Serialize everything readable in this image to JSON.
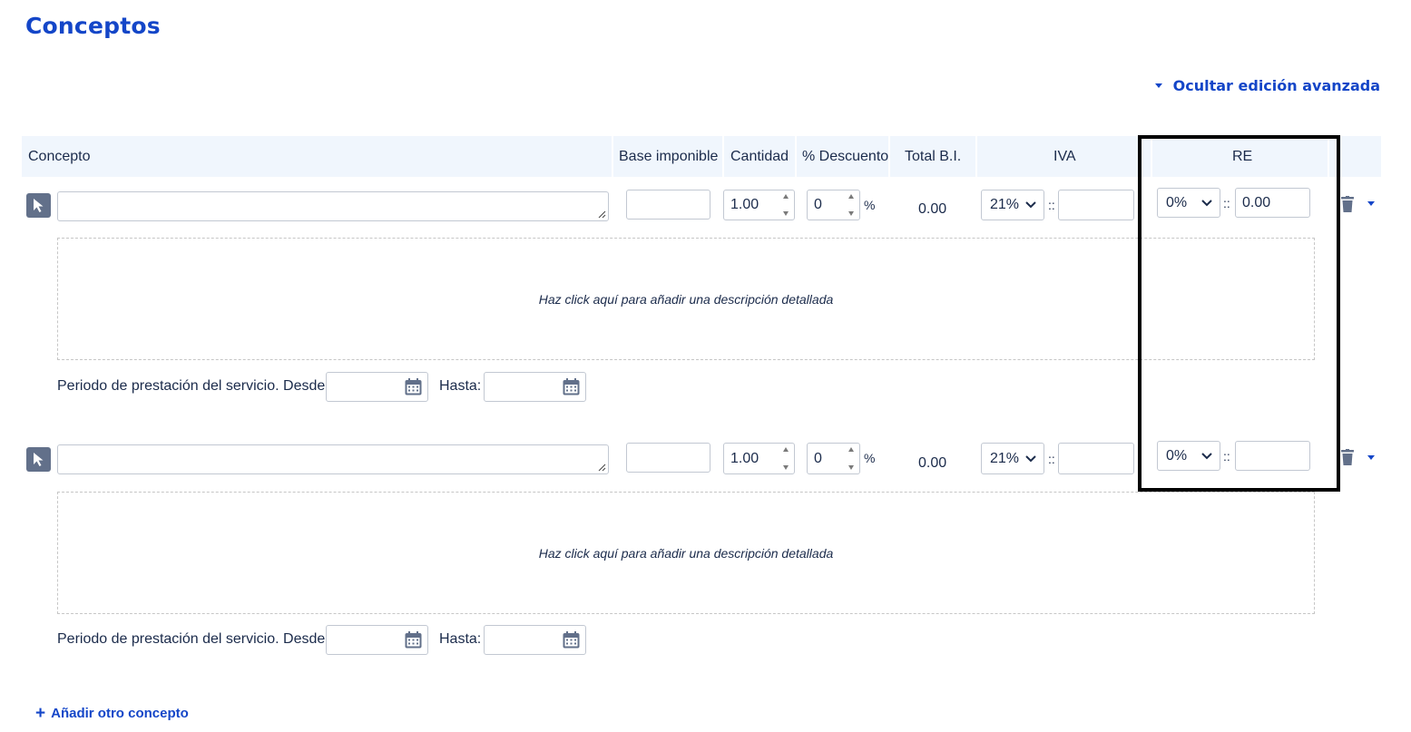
{
  "title": "Conceptos",
  "advanced_toggle": "Ocultar edición avanzada",
  "columns": {
    "concepto": "Concepto",
    "base": "Base imponible",
    "cantidad": "Cantidad",
    "descuento": "% Descuento",
    "total_bi": "Total B.I.",
    "iva": "IVA",
    "re": "RE"
  },
  "rows": [
    {
      "concept_value": "",
      "base_value": "",
      "cantidad": "1.00",
      "descuento": "0",
      "percent_sign": "%",
      "total_bi": "0.00",
      "iva_selected": "21%",
      "iva_amount": "",
      "separator": "::",
      "re_selected": "0%",
      "re_amount": "0.00",
      "description_placeholder": "Haz click aquí para añadir una descripción detallada",
      "period_label": "Periodo de prestación del servicio. Desde:",
      "hasta_label": "Hasta:",
      "desde_value": "",
      "hasta_value": ""
    },
    {
      "concept_value": "",
      "base_value": "",
      "cantidad": "1.00",
      "descuento": "0",
      "percent_sign": "%",
      "total_bi": "0.00",
      "iva_selected": "21%",
      "iva_amount": "",
      "separator": "::",
      "re_selected": "0%",
      "re_amount": "",
      "description_placeholder": "Haz click aquí para añadir una descripción detallada",
      "period_label": "Periodo de prestación del servicio. Desde:",
      "hasta_label": "Hasta:",
      "desde_value": "",
      "hasta_value": ""
    }
  ],
  "add_concept": "Añadir otro concepto",
  "add_symbol": "+",
  "colors": {
    "accent": "#1446c8",
    "header_bg": "#f0f6fd",
    "text": "#1b2b4b",
    "handle": "#62708a",
    "highlight_border": "#000000"
  },
  "icons": [
    "cursor-arrow-icon",
    "calendar-icon",
    "trash-icon",
    "caret-down-icon",
    "chevron-down-icon",
    "resize-grip-icon",
    "plus-icon"
  ]
}
